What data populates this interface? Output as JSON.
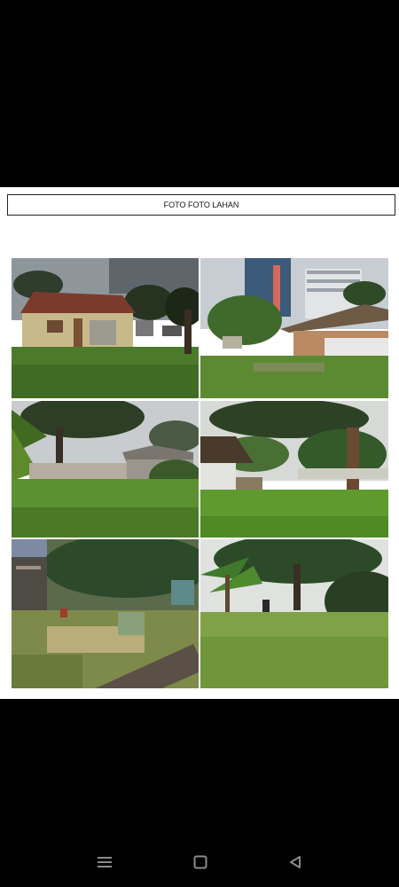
{
  "document": {
    "title": "FOTO FOTO LAHAN"
  },
  "photos": [
    {
      "name": "land-photo-1",
      "scene": "house-yard"
    },
    {
      "name": "land-photo-2",
      "scene": "city-shed"
    },
    {
      "name": "land-photo-3",
      "scene": "trees-palm"
    },
    {
      "name": "land-photo-4",
      "scene": "shed-field"
    },
    {
      "name": "land-photo-5",
      "scene": "dirt-yard"
    },
    {
      "name": "land-photo-6",
      "scene": "palm-field"
    }
  ],
  "navbar": {
    "recents_icon": "menu-lines-icon",
    "home_icon": "square-icon",
    "back_icon": "triangle-back-icon",
    "color": "#8a8a8a"
  }
}
